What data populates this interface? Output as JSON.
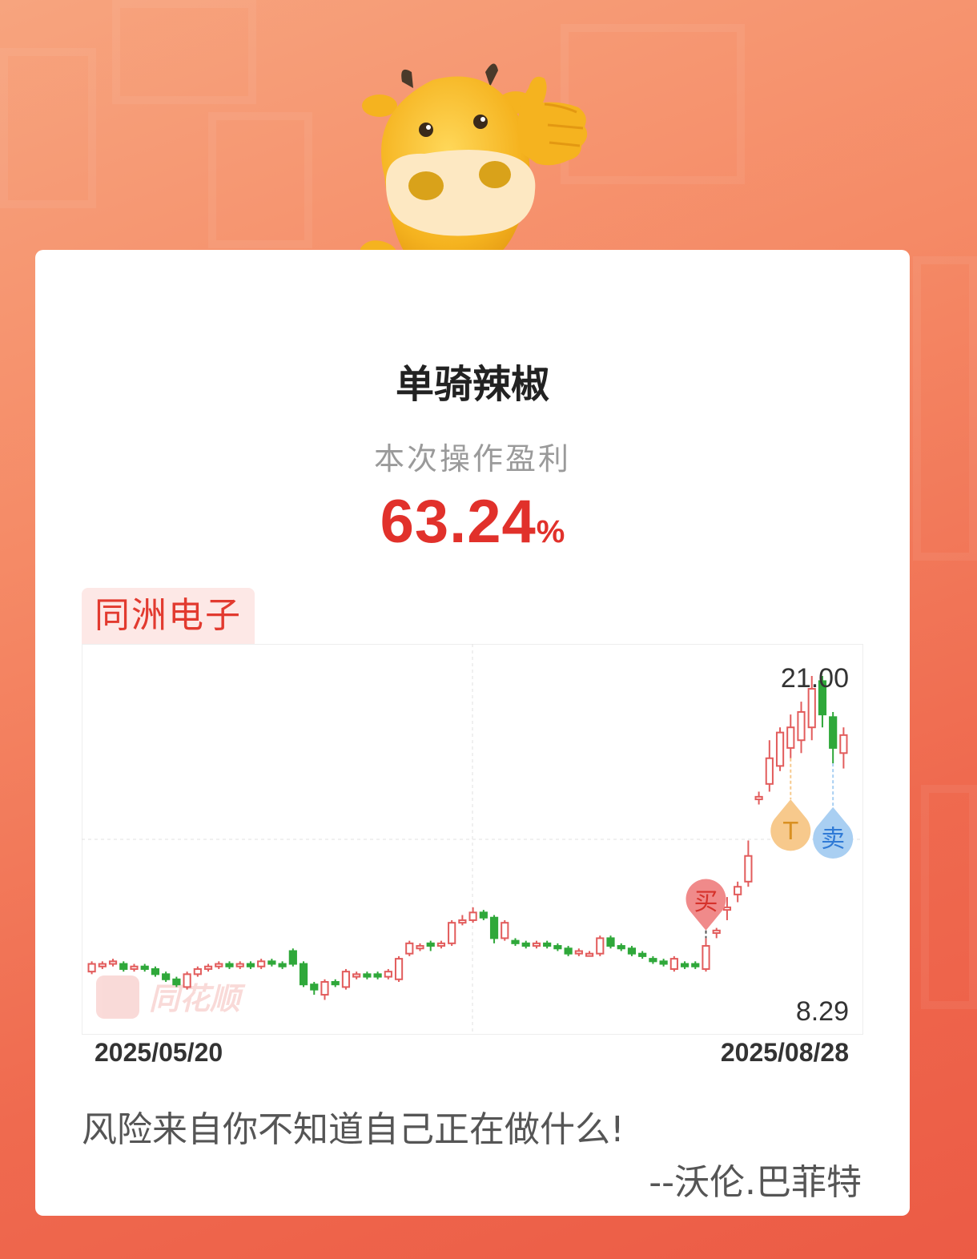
{
  "card": {
    "user_name": "单骑辣椒",
    "profit_label": "本次操作盈利",
    "profit_value": "63.24",
    "profit_unit": "%"
  },
  "stock": {
    "name": "同洲电子"
  },
  "watermark": "同花顺",
  "chart_data": {
    "type": "candlestick",
    "y_max_label": "21.00",
    "y_min_label": "8.29",
    "ylim": [
      8.29,
      21.0
    ],
    "x_start_label": "2025/05/20",
    "x_end_label": "2025/08/28",
    "grid": true,
    "colors": {
      "up": "#e25c5c",
      "down": "#2fa83a",
      "buy": "#f08a8a",
      "t": "#f7c98c",
      "sell": "#a9cff2"
    },
    "markers": [
      {
        "label": "买",
        "type": "buy",
        "index": 58,
        "value": 11.1
      },
      {
        "label": "T",
        "type": "t",
        "index": 66,
        "value": 16.2
      },
      {
        "label": "卖",
        "type": "sell",
        "index": 70,
        "value": 15.9
      }
    ],
    "candles": [
      [
        9.5,
        9.8,
        9.4,
        9.9
      ],
      [
        9.7,
        9.8,
        9.6,
        9.9
      ],
      [
        9.8,
        9.9,
        9.7,
        10.0
      ],
      [
        9.8,
        9.6,
        9.5,
        9.9
      ],
      [
        9.6,
        9.7,
        9.5,
        9.8
      ],
      [
        9.7,
        9.6,
        9.5,
        9.8
      ],
      [
        9.6,
        9.4,
        9.3,
        9.7
      ],
      [
        9.4,
        9.2,
        9.1,
        9.5
      ],
      [
        9.2,
        9.0,
        8.9,
        9.3
      ],
      [
        8.9,
        9.4,
        8.8,
        9.5
      ],
      [
        9.4,
        9.6,
        9.3,
        9.7
      ],
      [
        9.6,
        9.7,
        9.5,
        9.8
      ],
      [
        9.7,
        9.8,
        9.6,
        9.9
      ],
      [
        9.8,
        9.7,
        9.6,
        9.9
      ],
      [
        9.7,
        9.8,
        9.6,
        9.9
      ],
      [
        9.8,
        9.7,
        9.6,
        9.9
      ],
      [
        9.7,
        9.9,
        9.6,
        10.0
      ],
      [
        9.9,
        9.8,
        9.7,
        10.0
      ],
      [
        9.8,
        9.7,
        9.6,
        9.9
      ],
      [
        10.3,
        9.8,
        9.7,
        10.4
      ],
      [
        9.8,
        9.0,
        8.9,
        9.9
      ],
      [
        9.0,
        8.8,
        8.6,
        9.1
      ],
      [
        8.6,
        9.1,
        8.4,
        9.2
      ],
      [
        9.1,
        9.0,
        8.9,
        9.2
      ],
      [
        8.9,
        9.5,
        8.8,
        9.6
      ],
      [
        9.3,
        9.4,
        9.2,
        9.5
      ],
      [
        9.4,
        9.3,
        9.2,
        9.5
      ],
      [
        9.4,
        9.3,
        9.2,
        9.5
      ],
      [
        9.3,
        9.5,
        9.2,
        9.6
      ],
      [
        9.2,
        10.0,
        9.1,
        10.1
      ],
      [
        10.2,
        10.6,
        10.1,
        10.7
      ],
      [
        10.4,
        10.5,
        10.3,
        10.6
      ],
      [
        10.6,
        10.5,
        10.3,
        10.7
      ],
      [
        10.5,
        10.6,
        10.4,
        10.7
      ],
      [
        10.6,
        11.4,
        10.5,
        11.5
      ],
      [
        11.4,
        11.5,
        11.3,
        11.7
      ],
      [
        11.5,
        11.8,
        11.4,
        12.0
      ],
      [
        11.8,
        11.6,
        11.5,
        11.9
      ],
      [
        11.6,
        10.8,
        10.6,
        11.7
      ],
      [
        10.8,
        11.4,
        10.7,
        11.5
      ],
      [
        10.7,
        10.6,
        10.5,
        10.8
      ],
      [
        10.6,
        10.5,
        10.4,
        10.7
      ],
      [
        10.5,
        10.6,
        10.4,
        10.7
      ],
      [
        10.6,
        10.5,
        10.4,
        10.7
      ],
      [
        10.5,
        10.4,
        10.3,
        10.6
      ],
      [
        10.4,
        10.2,
        10.1,
        10.5
      ],
      [
        10.2,
        10.3,
        10.1,
        10.4
      ],
      [
        10.2,
        10.2,
        10.1,
        10.3
      ],
      [
        10.2,
        10.8,
        10.1,
        10.9
      ],
      [
        10.8,
        10.5,
        10.4,
        10.9
      ],
      [
        10.5,
        10.4,
        10.3,
        10.6
      ],
      [
        10.4,
        10.2,
        10.1,
        10.5
      ],
      [
        10.2,
        10.1,
        10.0,
        10.3
      ],
      [
        10.0,
        9.9,
        9.8,
        10.1
      ],
      [
        9.9,
        9.8,
        9.7,
        10.0
      ],
      [
        9.6,
        10.0,
        9.5,
        10.1
      ],
      [
        9.8,
        9.7,
        9.6,
        9.9
      ],
      [
        9.8,
        9.7,
        9.6,
        9.9
      ],
      [
        9.6,
        10.5,
        9.5,
        10.8
      ],
      [
        11.0,
        11.1,
        10.8,
        11.2
      ],
      [
        11.9,
        12.0,
        11.5,
        12.4
      ],
      [
        12.5,
        12.8,
        12.2,
        13.0
      ],
      [
        13.0,
        14.0,
        12.8,
        14.6
      ],
      [
        16.2,
        16.3,
        16.0,
        16.5
      ],
      [
        16.8,
        17.8,
        16.5,
        18.5
      ],
      [
        17.5,
        18.8,
        17.3,
        19.0
      ],
      [
        18.2,
        19.0,
        17.8,
        19.5
      ],
      [
        18.5,
        19.6,
        18.0,
        20.0
      ],
      [
        19.0,
        20.5,
        18.5,
        21.0
      ],
      [
        20.8,
        19.5,
        19.0,
        21.0
      ],
      [
        19.4,
        18.2,
        17.6,
        19.6
      ],
      [
        18.0,
        18.7,
        17.4,
        19.0
      ]
    ]
  }
}
